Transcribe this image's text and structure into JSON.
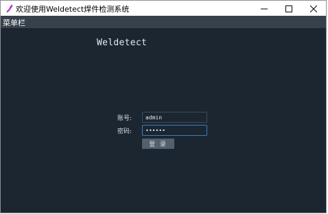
{
  "window": {
    "title": "欢迎使用Weldetect焊件检测系统",
    "app_icon": "feather-pen-icon",
    "controls": {
      "minimize_icon": "minimize-icon",
      "maximize_icon": "maximize-icon",
      "close_icon": "close-icon"
    }
  },
  "menubar": {
    "label": "菜单栏"
  },
  "login": {
    "app_name": "Weldetect",
    "username_label": "账号:",
    "username_value": "admin",
    "password_label": "密码:",
    "password_value": "••••••",
    "submit_label": "登 录"
  },
  "colors": {
    "background": "#1c2631",
    "menubar": "#37414b",
    "button": "#53606d",
    "focus_border": "#3d7fc0"
  }
}
